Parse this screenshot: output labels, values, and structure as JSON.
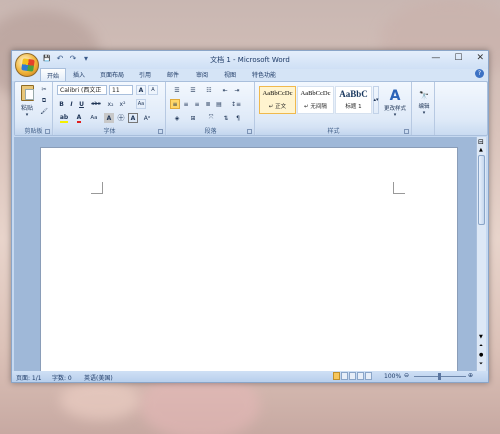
{
  "window": {
    "title": "文档 1 - Microsoft Word",
    "controls": {
      "minimize": "—",
      "maximize": "☐",
      "close": "✕"
    }
  },
  "quick_access": {
    "save": "💾",
    "undo": "↶",
    "redo": "↷",
    "more": "▾"
  },
  "tabs": [
    {
      "label": "开始"
    },
    {
      "label": "插入"
    },
    {
      "label": "页面布局"
    },
    {
      "label": "引用"
    },
    {
      "label": "邮件"
    },
    {
      "label": "审阅"
    },
    {
      "label": "视图"
    },
    {
      "label": "特色功能"
    }
  ],
  "ribbon": {
    "clipboard": {
      "paste_label": "粘贴",
      "group_label": "剪贴板"
    },
    "font": {
      "font_name": "Calibri (西文正",
      "font_size": "11",
      "group_label": "字体",
      "bold": "B",
      "italic": "I",
      "underline": "U",
      "strike": "abe",
      "sub": "x₂",
      "sup": "x²",
      "grow": "A",
      "shrink": "A",
      "clear": "Aa",
      "change_case": "Aa",
      "char_border": "A",
      "phonetic": "A"
    },
    "paragraph": {
      "group_label": "段落"
    },
    "styles": {
      "group_label": "样式",
      "items": [
        {
          "sample": "AaBbCcDc",
          "name": "↵ 正文"
        },
        {
          "sample": "AaBbCcDc",
          "name": "↵ 无间隔"
        },
        {
          "sample": "AaBbC",
          "name": "标题 1"
        }
      ],
      "change_styles": "更改样式",
      "change_styles_glyph": "A"
    },
    "editing": {
      "label": "编辑",
      "glyph": "🔭"
    }
  },
  "statusbar": {
    "page": "页面: 1/1",
    "words": "字数: 0",
    "language": "英语(美国)",
    "zoom": "100%"
  }
}
